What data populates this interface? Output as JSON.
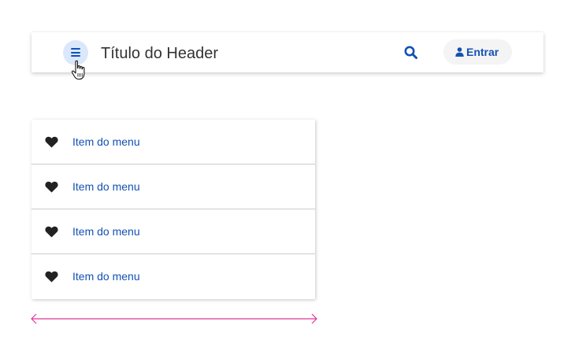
{
  "header": {
    "title": "Título do Header",
    "menu_icon": "hamburger-menu-icon",
    "search_icon": "search-icon",
    "login_icon": "user-icon",
    "login_label": "Entrar"
  },
  "menu": {
    "items": [
      {
        "icon": "heart-icon",
        "label": "Item do menu"
      },
      {
        "icon": "heart-icon",
        "label": "Item do menu"
      },
      {
        "icon": "heart-icon",
        "label": "Item do menu"
      },
      {
        "icon": "heart-icon",
        "label": "Item do menu"
      }
    ]
  },
  "colors": {
    "primary": "#1351b4",
    "menu_button_bg": "#dbe8fb",
    "login_button_bg": "#f4f4f4",
    "title_text": "#333333",
    "divider": "#cccccc",
    "measure_line": "#e0359a",
    "heart": "#222222"
  }
}
